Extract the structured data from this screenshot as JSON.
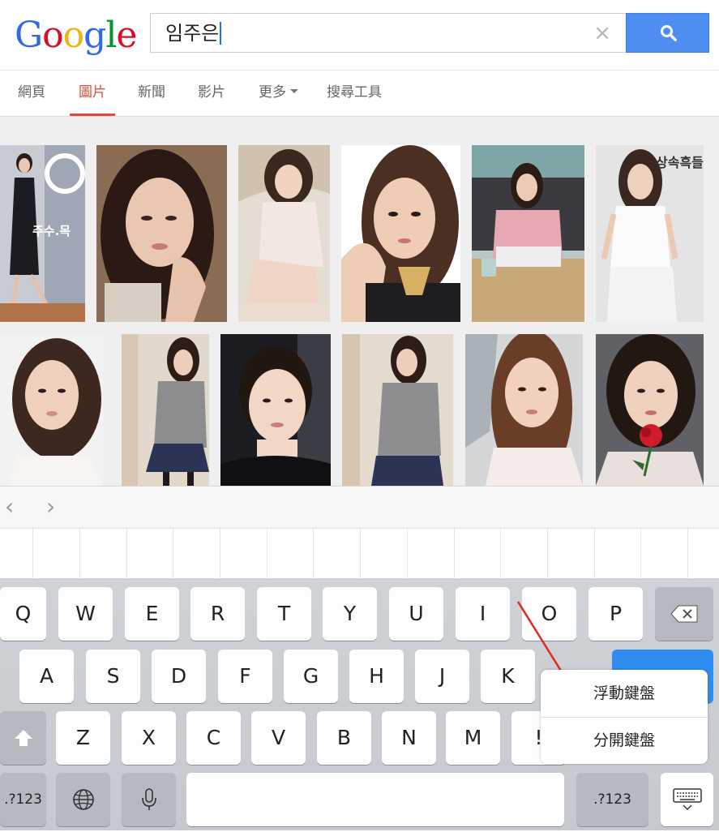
{
  "header": {
    "logo": [
      "G",
      "o",
      "o",
      "g",
      "l",
      "e"
    ],
    "logo_colors": [
      "#3369e8",
      "#d50f25",
      "#eeb211",
      "#3369e8",
      "#009925",
      "#d50f25"
    ],
    "search_query": "임주은",
    "clear_symbol": "×"
  },
  "tabs": [
    {
      "label": "網頁"
    },
    {
      "label": "圖片"
    },
    {
      "label": "新聞"
    },
    {
      "label": "影片"
    },
    {
      "label": "更多"
    },
    {
      "label": "搜尋工具"
    }
  ],
  "thumbnails": {
    "overlay_text_1": "주수.목",
    "overlay_text_2": "상속흑들"
  },
  "accessory": {
    "back": "‹",
    "forward": "›"
  },
  "keyboard": {
    "row1": [
      "Q",
      "W",
      "E",
      "R",
      "T",
      "Y",
      "U",
      "I",
      "O",
      "P"
    ],
    "row2": [
      "A",
      "S",
      "D",
      "F",
      "G",
      "H",
      "J",
      "K"
    ],
    "row3": [
      "Z",
      "X",
      "C",
      "V",
      "B",
      "N",
      "M",
      "!"
    ],
    "numbers_left": ".?123",
    "numbers_right": ".?123"
  },
  "popup": {
    "items": [
      "浮動鍵盤",
      "分開鍵盤"
    ]
  },
  "colors": {
    "accent_red": "#dd4b39",
    "search_blue": "#4d8ef0",
    "key_blue": "#2f8cf0"
  }
}
